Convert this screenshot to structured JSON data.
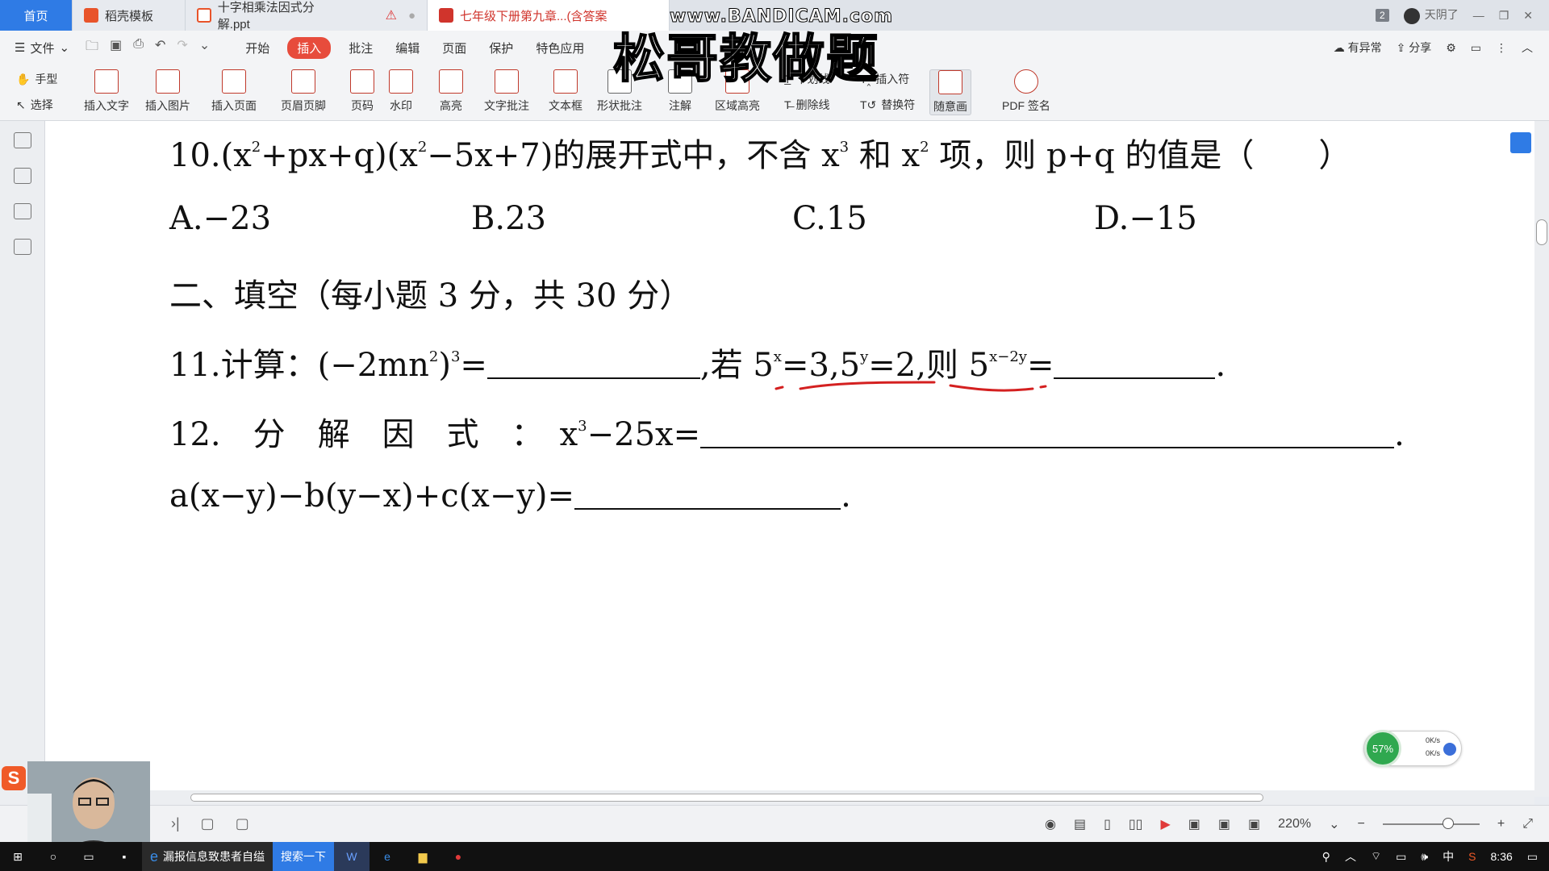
{
  "tabs": {
    "home": "首页",
    "template": "稻壳模板",
    "ppt": "十字相乘法因式分解.ppt",
    "pdf": "七年级下册第九章...(含答案"
  },
  "window": {
    "badge": "2",
    "user": "天阴了"
  },
  "menu": {
    "file": "文件",
    "items": [
      "开始",
      "插入",
      "批注",
      "编辑",
      "页面",
      "保护",
      "特色应用"
    ],
    "right": {
      "anomaly": "有异常",
      "share": "分享"
    }
  },
  "ribbon": {
    "hand": "手型",
    "select": "选择",
    "buttons": [
      "插入文字",
      "插入图片",
      "插入页面",
      "页眉页脚",
      "页码",
      "水印",
      "高亮",
      "文字批注",
      "文本框",
      "形状批注",
      "注解",
      "区域高亮"
    ],
    "small": {
      "underline": "下划线",
      "strikethrough": "删除线",
      "insert_mark": "插入符",
      "replace_mark": "替换符"
    },
    "freehand": "随意画",
    "pdf_sign": "PDF 签名"
  },
  "overlay": {
    "watermark_url": "www.BANDICAM.com",
    "watermark_title": "松哥教做题"
  },
  "document": {
    "q10": {
      "prefix": "10.(x",
      "p1": "+px+q)(x",
      "p2": "−5x+7)的展开式中，不含 x",
      "p3": " 和 x",
      "p4": " 项，则 p+q 的值是（　　）",
      "sup2": "2",
      "sup3": "3"
    },
    "options": [
      "A.−23",
      "B.23",
      "C.15",
      "D.−15"
    ],
    "section2": "二、填空（每小题 3 分，共 30 分）",
    "q11": {
      "a": "11.计算：(−2mn",
      "b": ")",
      "c": "=",
      "d": ",若 5",
      "e": "=3,5",
      "f": "=2,则 5",
      "g": "=",
      "h": ".",
      "sup_x": "x",
      "sup_y": "y",
      "sup_x2y": "x−2y",
      "sup2": "2",
      "sup3": "3"
    },
    "q12": {
      "a": "12.　分　解　因　式　：　x",
      "b": "−25x=",
      "c": ".",
      "sup3": "3"
    },
    "q12b": {
      "a": "a(x−y)−b(y−x)+c(x−y)=",
      "b": "."
    }
  },
  "status": {
    "zoom": "220%"
  },
  "network": {
    "percent": "57%",
    "up": "0K/s",
    "down": "0K/s"
  },
  "taskbar": {
    "news": "漏报信息致患者自缢",
    "search": "搜索一下",
    "ime": "中",
    "time": "8:36"
  },
  "colors": {
    "accent": "#2f7be5",
    "insert_tab": "#e74c3c",
    "annotation_red": "#d42020"
  }
}
